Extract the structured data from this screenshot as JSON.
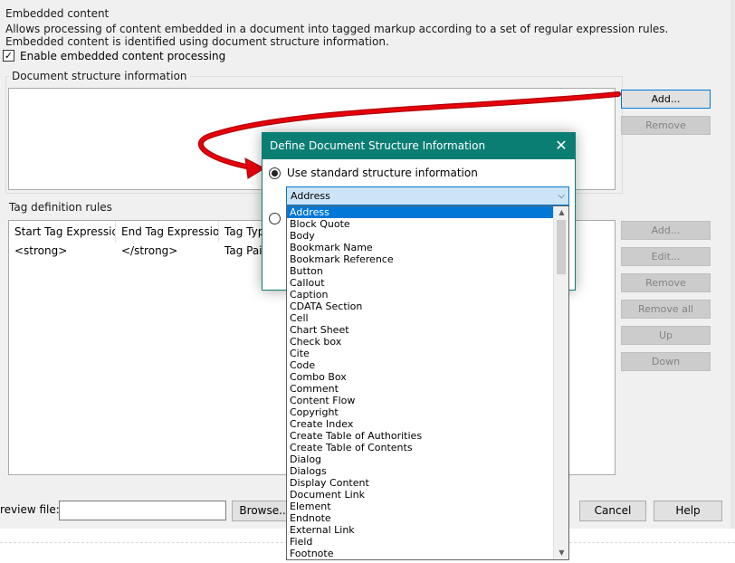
{
  "embedded": {
    "group_title": "Embedded content",
    "description": "Allows processing of content embedded in a document into tagged markup according to a set of regular expression rules. Embedded content is identified using document structure information.",
    "enable_label": "Enable embedded content processing",
    "enable_checked": "✓"
  },
  "doc_structure": {
    "title": "Document structure information",
    "add_label": "Add...",
    "remove_label": "Remove"
  },
  "tag_rules": {
    "title": "Tag definition rules",
    "columns": [
      "Start Tag Expression",
      "End Tag Expression",
      "Tag Type"
    ],
    "rows": [
      {
        "start": "<strong>",
        "end": "</strong>",
        "type": "Tag Pair"
      }
    ],
    "buttons": {
      "add": "Add...",
      "edit": "Edit...",
      "remove": "Remove",
      "remove_all": "Remove all",
      "up": "Up",
      "down": "Down"
    }
  },
  "footer": {
    "preview_label": "review file:",
    "preview_value": "",
    "browse_label": "Browse...",
    "cancel_label": "Cancel",
    "help_label": "Help"
  },
  "dialog": {
    "title": "Define Document Structure Information",
    "close_glyph": "✕",
    "radio_standard_label": "Use standard structure information",
    "combo_value": "Address",
    "combo_arrow": "⌵"
  },
  "dropdown": {
    "items": [
      "Address",
      "Block Quote",
      "Body",
      "Bookmark Name",
      "Bookmark Reference",
      "Button",
      "Callout",
      "Caption",
      "CDATA Section",
      "Cell",
      "Chart Sheet",
      "Check box",
      "Cite",
      "Code",
      "Combo Box",
      "Comment",
      "Content Flow",
      "Copyright",
      "Create Index",
      "Create Table of Authorities",
      "Create Table of Contents",
      "Dialog",
      "Dialogs",
      "Display Content",
      "Document Link",
      "Element",
      "Endnote",
      "External Link",
      "Field",
      "Footnote"
    ],
    "selected_index": 0,
    "scroll_up": "▲",
    "scroll_down": "▼"
  },
  "colors": {
    "dialog_accent": "#0b7e74",
    "selection": "#0078d7",
    "arrow": "#e8000b"
  }
}
